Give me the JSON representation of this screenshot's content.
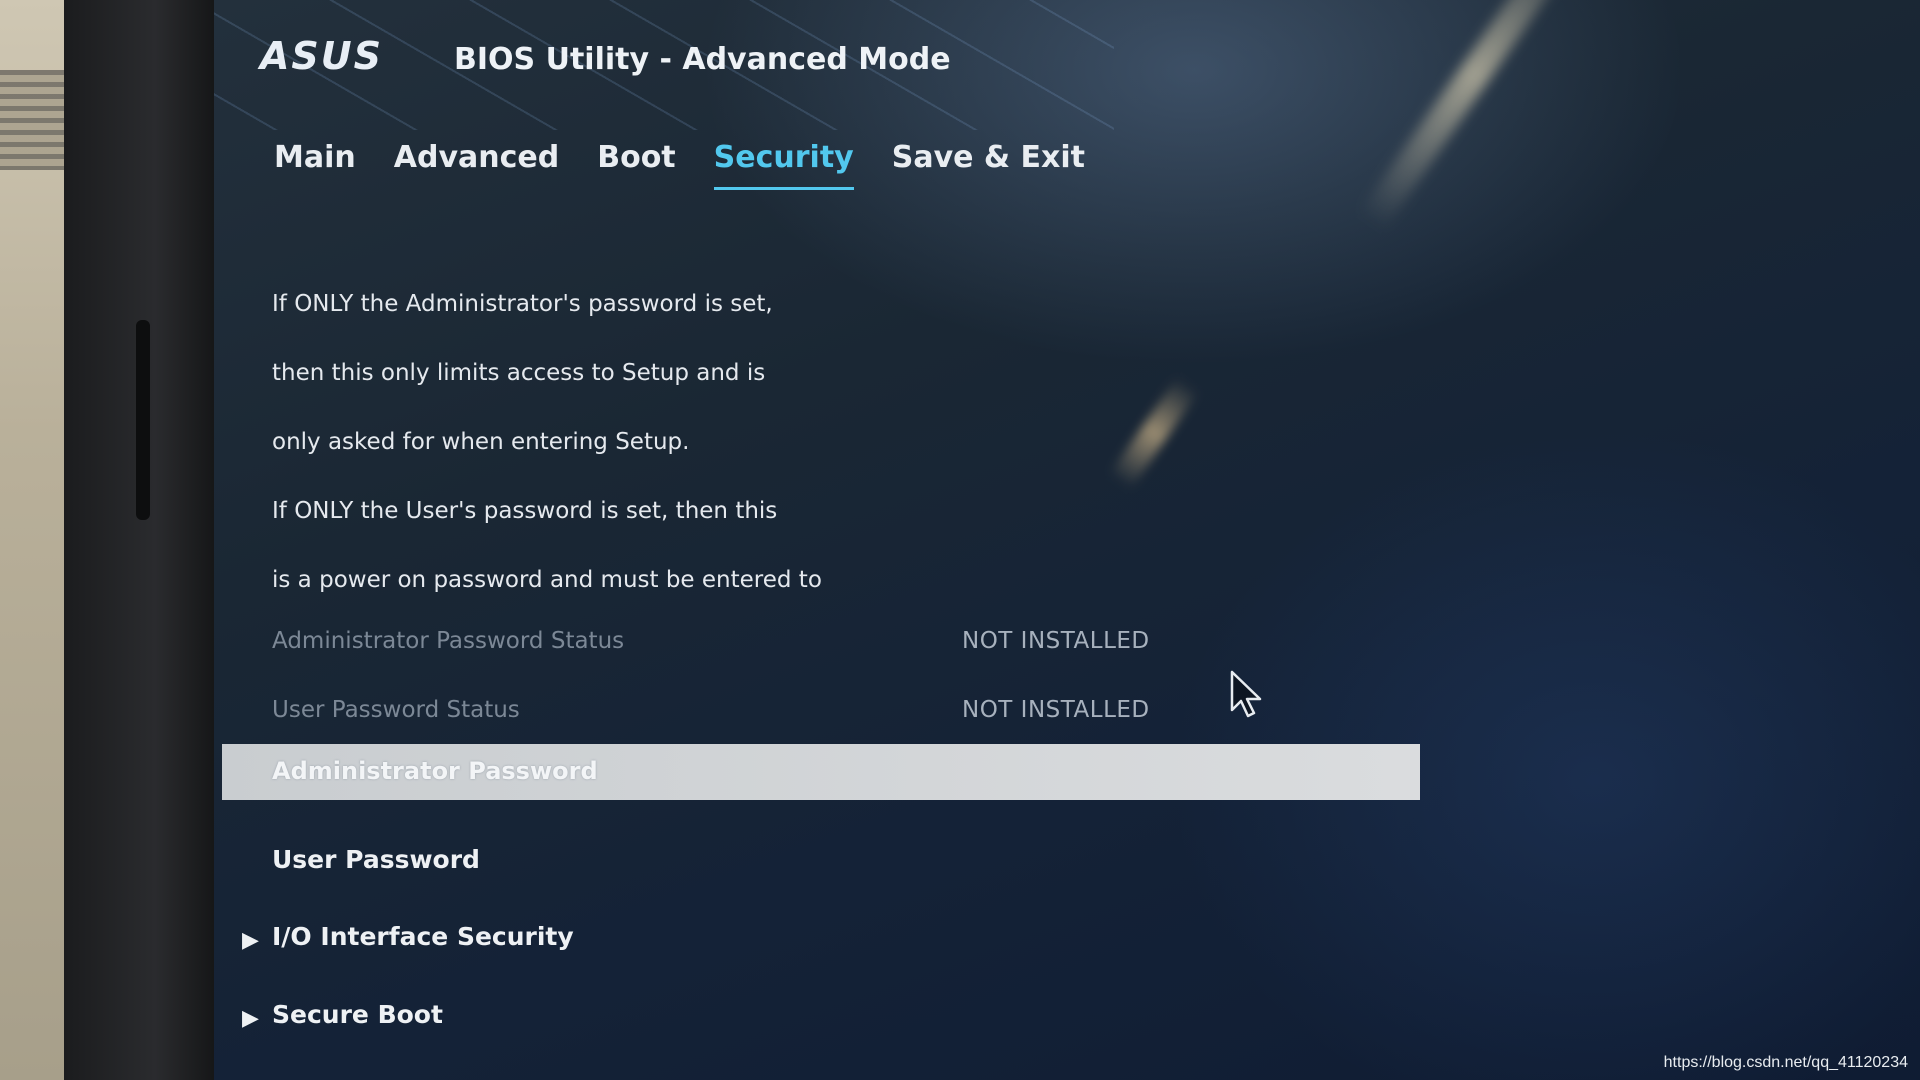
{
  "header": {
    "logo_text": "ASUS",
    "title": "BIOS Utility - Advanced Mode"
  },
  "tabs": [
    {
      "label": "Main",
      "active": false
    },
    {
      "label": "Advanced",
      "active": false
    },
    {
      "label": "Boot",
      "active": false
    },
    {
      "label": "Security",
      "active": true
    },
    {
      "label": "Save & Exit",
      "active": false
    }
  ],
  "description_lines": [
    "If ONLY the Administrator's password is set,",
    "then this only limits access to Setup and is",
    "only asked for when entering Setup.",
    "If ONLY the User's password is set, then this",
    "is a power on password and must be entered to"
  ],
  "status": {
    "admin_label": "Administrator Password Status",
    "admin_value": "NOT INSTALLED",
    "user_label": "User Password Status",
    "user_value": "NOT INSTALLED"
  },
  "menu": {
    "selected_item": "Administrator Password",
    "user_password": "User Password",
    "io_security": "I/O Interface Security",
    "secure_boot": "Secure Boot"
  },
  "colors": {
    "accent": "#52c8ee",
    "selected_bar": "#d4d7da",
    "status_text": "#7c8896"
  },
  "icons": {
    "submenu": "chevron-right-icon",
    "pointer": "mouse-cursor-icon"
  },
  "watermark": "https://blog.csdn.net/qq_41120234"
}
